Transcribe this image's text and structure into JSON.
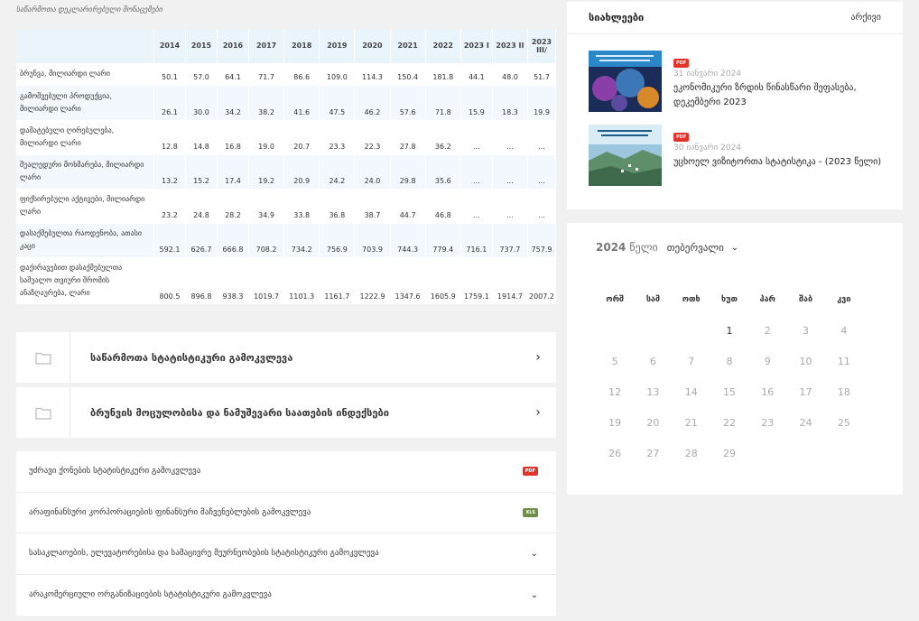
{
  "caption": "საწარმოთა დეკლარირებული მონაცემები",
  "table": {
    "headers": [
      "",
      "2014",
      "2015",
      "2016",
      "2017",
      "2018",
      "2019",
      "2020",
      "2021",
      "2022",
      "2023 I",
      "2023 II",
      "2023 III/"
    ],
    "rows": [
      {
        "label": "ბრუნვა, მილიარდი ლარი",
        "values": [
          "50.1",
          "57.0",
          "64.1",
          "71.7",
          "86.6",
          "109.0",
          "114.3",
          "150.4",
          "181.8",
          "44.1",
          "48.0",
          "51.7"
        ]
      },
      {
        "label": "გამოშვებული პროდუქცია, მილიარდი ლარი",
        "values": [
          "26.1",
          "30.0",
          "34.2",
          "38.2",
          "41.6",
          "47.5",
          "46.2",
          "57.6",
          "71.8",
          "15.9",
          "18.3",
          "19.9"
        ]
      },
      {
        "label": "დამატებული ღირებულება, მილიარდი ლარი",
        "values": [
          "12.8",
          "14.8",
          "16.8",
          "19.0",
          "20.7",
          "23.3",
          "22.3",
          "27.8",
          "36.2",
          "...",
          "...",
          "..."
        ]
      },
      {
        "label": "შუალედური მოხმარება, მილიარდი ლარი",
        "values": [
          "13.2",
          "15.2",
          "17.4",
          "19.2",
          "20.9",
          "24.2",
          "24.0",
          "29.8",
          "35.6",
          "...",
          "...",
          "..."
        ]
      },
      {
        "label": "ფიქსირებული აქტივები, მილიარდი ლარი",
        "values": [
          "23.2",
          "24.8",
          "28.2",
          "34.9",
          "33.8",
          "36.8",
          "38.7",
          "44.7",
          "46.8",
          "...",
          "...",
          "..."
        ]
      },
      {
        "label": "დასაქმებულთა რაოდენობა, ათასი კაცი",
        "values": [
          "592.1",
          "626.7",
          "666.8",
          "708.2",
          "734.2",
          "756.9",
          "703.9",
          "744.3",
          "779.4",
          "716.1",
          "737.7",
          "757.9"
        ]
      },
      {
        "label": "დაქირავებით დასაქმებულთა საშუალო თვიური შრომის ანაზღაურება, ლარი",
        "values": [
          "800.5",
          "896.8",
          "938.3",
          "1019.7",
          "1101.3",
          "1161.7",
          "1222.9",
          "1347.6",
          "1605.9",
          "1759.1",
          "1914.7",
          "2007.2"
        ]
      }
    ]
  },
  "accordions": [
    {
      "title": "საწარმოთა სტატისტიკური გამოკვლევა"
    },
    {
      "title": "ბრუნვის მოცულობისა და ნამუშევარი საათების ინდექსები"
    }
  ],
  "list": [
    {
      "label": "უძრავი ქონების სტატისტიკური გამოკვლევა",
      "badge": "PDF"
    },
    {
      "label": "არაფინანსური კორპორაციების ფინანსური მაჩვენებლების გამოკვლევა",
      "badge": "XLS"
    },
    {
      "label": "სასაკლაოების, ელევატორებისა და სამაცივრე მეურნეობების სტატისტიკური გამოკვლევა"
    },
    {
      "label": "არაკომერციული ორგანიზაციების სტატისტიკური გამოკვლევა"
    }
  ],
  "news": {
    "heading": "სიახლეები",
    "archive": "არქივი",
    "items": [
      {
        "badge": "PDF",
        "date": "31 იანვარი 2024",
        "title": "ეკონომიკური ზრდის წინასწარი შეფასება, დეკემბერი 2023"
      },
      {
        "badge": "PDF",
        "date": "30 იანვარი 2024",
        "title": "უცხოელ ვიზიტორთა სტატისტიკა - (2023 წელი)"
      }
    ]
  },
  "calendar": {
    "year": "2024",
    "year_word": "წელი",
    "month": "თებერვალი",
    "weekdays": [
      "ორშ",
      "სამ",
      "ოთხ",
      "ხუთ",
      "პარ",
      "შაბ",
      "კვი"
    ],
    "weeks": [
      [
        "",
        "",
        "",
        "1",
        "2",
        "3",
        "4"
      ],
      [
        "5",
        "6",
        "7",
        "8",
        "9",
        "10",
        "11"
      ],
      [
        "12",
        "13",
        "14",
        "15",
        "16",
        "17",
        "18"
      ],
      [
        "19",
        "20",
        "21",
        "22",
        "23",
        "24",
        "25"
      ],
      [
        "26",
        "27",
        "28",
        "29",
        "",
        "",
        ""
      ]
    ],
    "active_days": [
      "1"
    ]
  },
  "colors": {
    "pdf": "#e2332b",
    "xls": "#6e8d45",
    "header_bg": "#eaf4fb"
  }
}
